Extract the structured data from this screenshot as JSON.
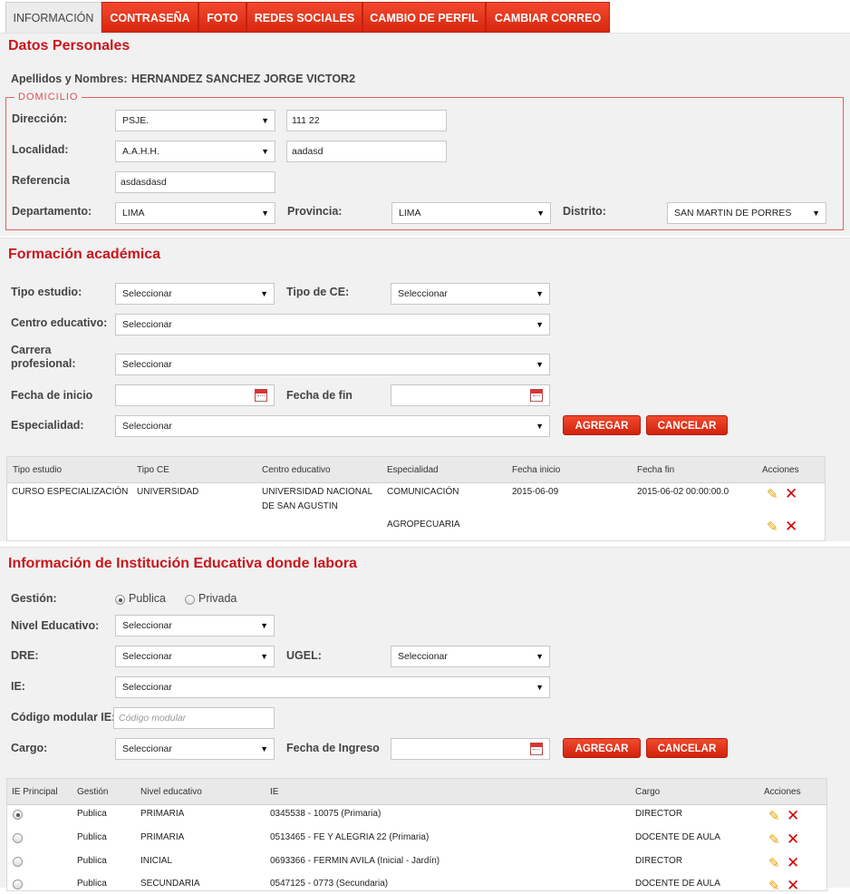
{
  "tabs": [
    "INFORMACIÓN",
    "CONTRASEÑA",
    "FOTO",
    "REDES SOCIALES",
    "CAMBIO DE PERFIL",
    "CAMBIAR CORREO"
  ],
  "personal": {
    "title": "Datos Personales",
    "name_label": "Apellidos y Nombres:",
    "name_value": "HERNANDEZ SANCHEZ JORGE VICTOR2",
    "legend": "DOMICILIO",
    "direccion_label": "Dirección:",
    "direccion_select": "PSJE.",
    "direccion_text": "111 22",
    "localidad_label": "Localidad:",
    "localidad_select": "A.A.H.H.",
    "localidad_text": "aadasd",
    "referencia_label": "Referencia",
    "referencia_text": "asdasdasd",
    "departamento_label": "Departamento:",
    "departamento_value": "LIMA",
    "provincia_label": "Provincia:",
    "provincia_value": "LIMA",
    "distrito_label": "Distrito:",
    "distrito_value": "SAN MARTIN DE PORRES"
  },
  "academic": {
    "title": "Formación académica",
    "tipo_estudio_label": "Tipo estudio:",
    "tipo_estudio_value": "Seleccionar",
    "tipo_ce_label": "Tipo de CE:",
    "tipo_ce_value": "Seleccionar",
    "centro_label": "Centro educativo:",
    "centro_value": "Seleccionar",
    "carrera_label_1": "Carrera",
    "carrera_label_2": "profesional:",
    "carrera_value": "Seleccionar",
    "fecha_inicio_label": "Fecha de inicio",
    "fecha_fin_label": "Fecha de fin",
    "especialidad_label": "Especialidad:",
    "especialidad_value": "Seleccionar",
    "add_button": "AGREGAR",
    "cancel_button": "CANCELAR",
    "columns": [
      "Tipo estudio",
      "Tipo CE",
      "Centro educativo",
      "Especialidad",
      "Fecha inicio",
      "Fecha fin",
      "Acciones"
    ],
    "rows": [
      {
        "tipo_estudio": "CURSO ESPECIALIZACIÓN",
        "tipo_ce": "UNIVERSIDAD",
        "centro_1": "UNIVERSIDAD NACIONAL",
        "centro_2": "DE SAN AGUSTIN",
        "especialidad": "COMUNICACIÓN",
        "fecha_inicio": "2015-06-09",
        "fecha_fin": "2015-06-02 00:00:00.0"
      },
      {
        "tipo_estudio": "",
        "tipo_ce": "",
        "centro_1": "",
        "centro_2": "",
        "especialidad": "AGROPECUARIA",
        "fecha_inicio": "",
        "fecha_fin": ""
      }
    ]
  },
  "institution": {
    "title": "Información de Institución Educativa donde labora",
    "gestion_label": "Gestión:",
    "gestion_options": [
      "Publica",
      "Privada"
    ],
    "nivel_label": "Nivel Educativo:",
    "nivel_value": "Seleccionar",
    "dre_label": "DRE:",
    "dre_value": "Seleccionar",
    "ugel_label": "UGEL:",
    "ugel_value": "Seleccionar",
    "ie_label": "IE:",
    "ie_value": "Seleccionar",
    "codigo_label": "Código modular IE:",
    "codigo_placeholder": "Código modular",
    "cargo_label": "Cargo:",
    "cargo_value": "Seleccionar",
    "fecha_ingreso_label": "Fecha de Ingreso",
    "add_button": "AGREGAR",
    "cancel_button": "CANCELAR",
    "columns": [
      "IE Principal",
      "Gestión",
      "Nivel educativo",
      "IE",
      "Cargo",
      "Acciones"
    ],
    "rows": [
      {
        "principal": true,
        "gestion": "Publica",
        "nivel": "PRIMARIA",
        "ie": "0345538 - 10075 (Primaria)",
        "cargo": "DIRECTOR"
      },
      {
        "principal": false,
        "gestion": "Publica",
        "nivel": "PRIMARIA",
        "ie": "0513465 - FE Y ALEGRIA 22 (Primaria)",
        "cargo": "DOCENTE DE AULA"
      },
      {
        "principal": false,
        "gestion": "Publica",
        "nivel": "INICIAL",
        "ie": "0693366 - FERMIN AVILA (Inicial - Jardín)",
        "cargo": "DIRECTOR"
      },
      {
        "principal": false,
        "gestion": "Publica",
        "nivel": "SECUNDARIA",
        "ie": "0547125 - 0773 (Secundaria)",
        "cargo": "DOCENTE DE AULA"
      }
    ]
  },
  "icons": {
    "edit": "pencil-icon",
    "delete": "x-icon",
    "calendar": "calendar-icon",
    "dropdown": "chevron-down-icon"
  },
  "colors": {
    "accent": "#c8171d",
    "tab_red": "#e03018",
    "panel_bg": "#f1f1f1"
  }
}
